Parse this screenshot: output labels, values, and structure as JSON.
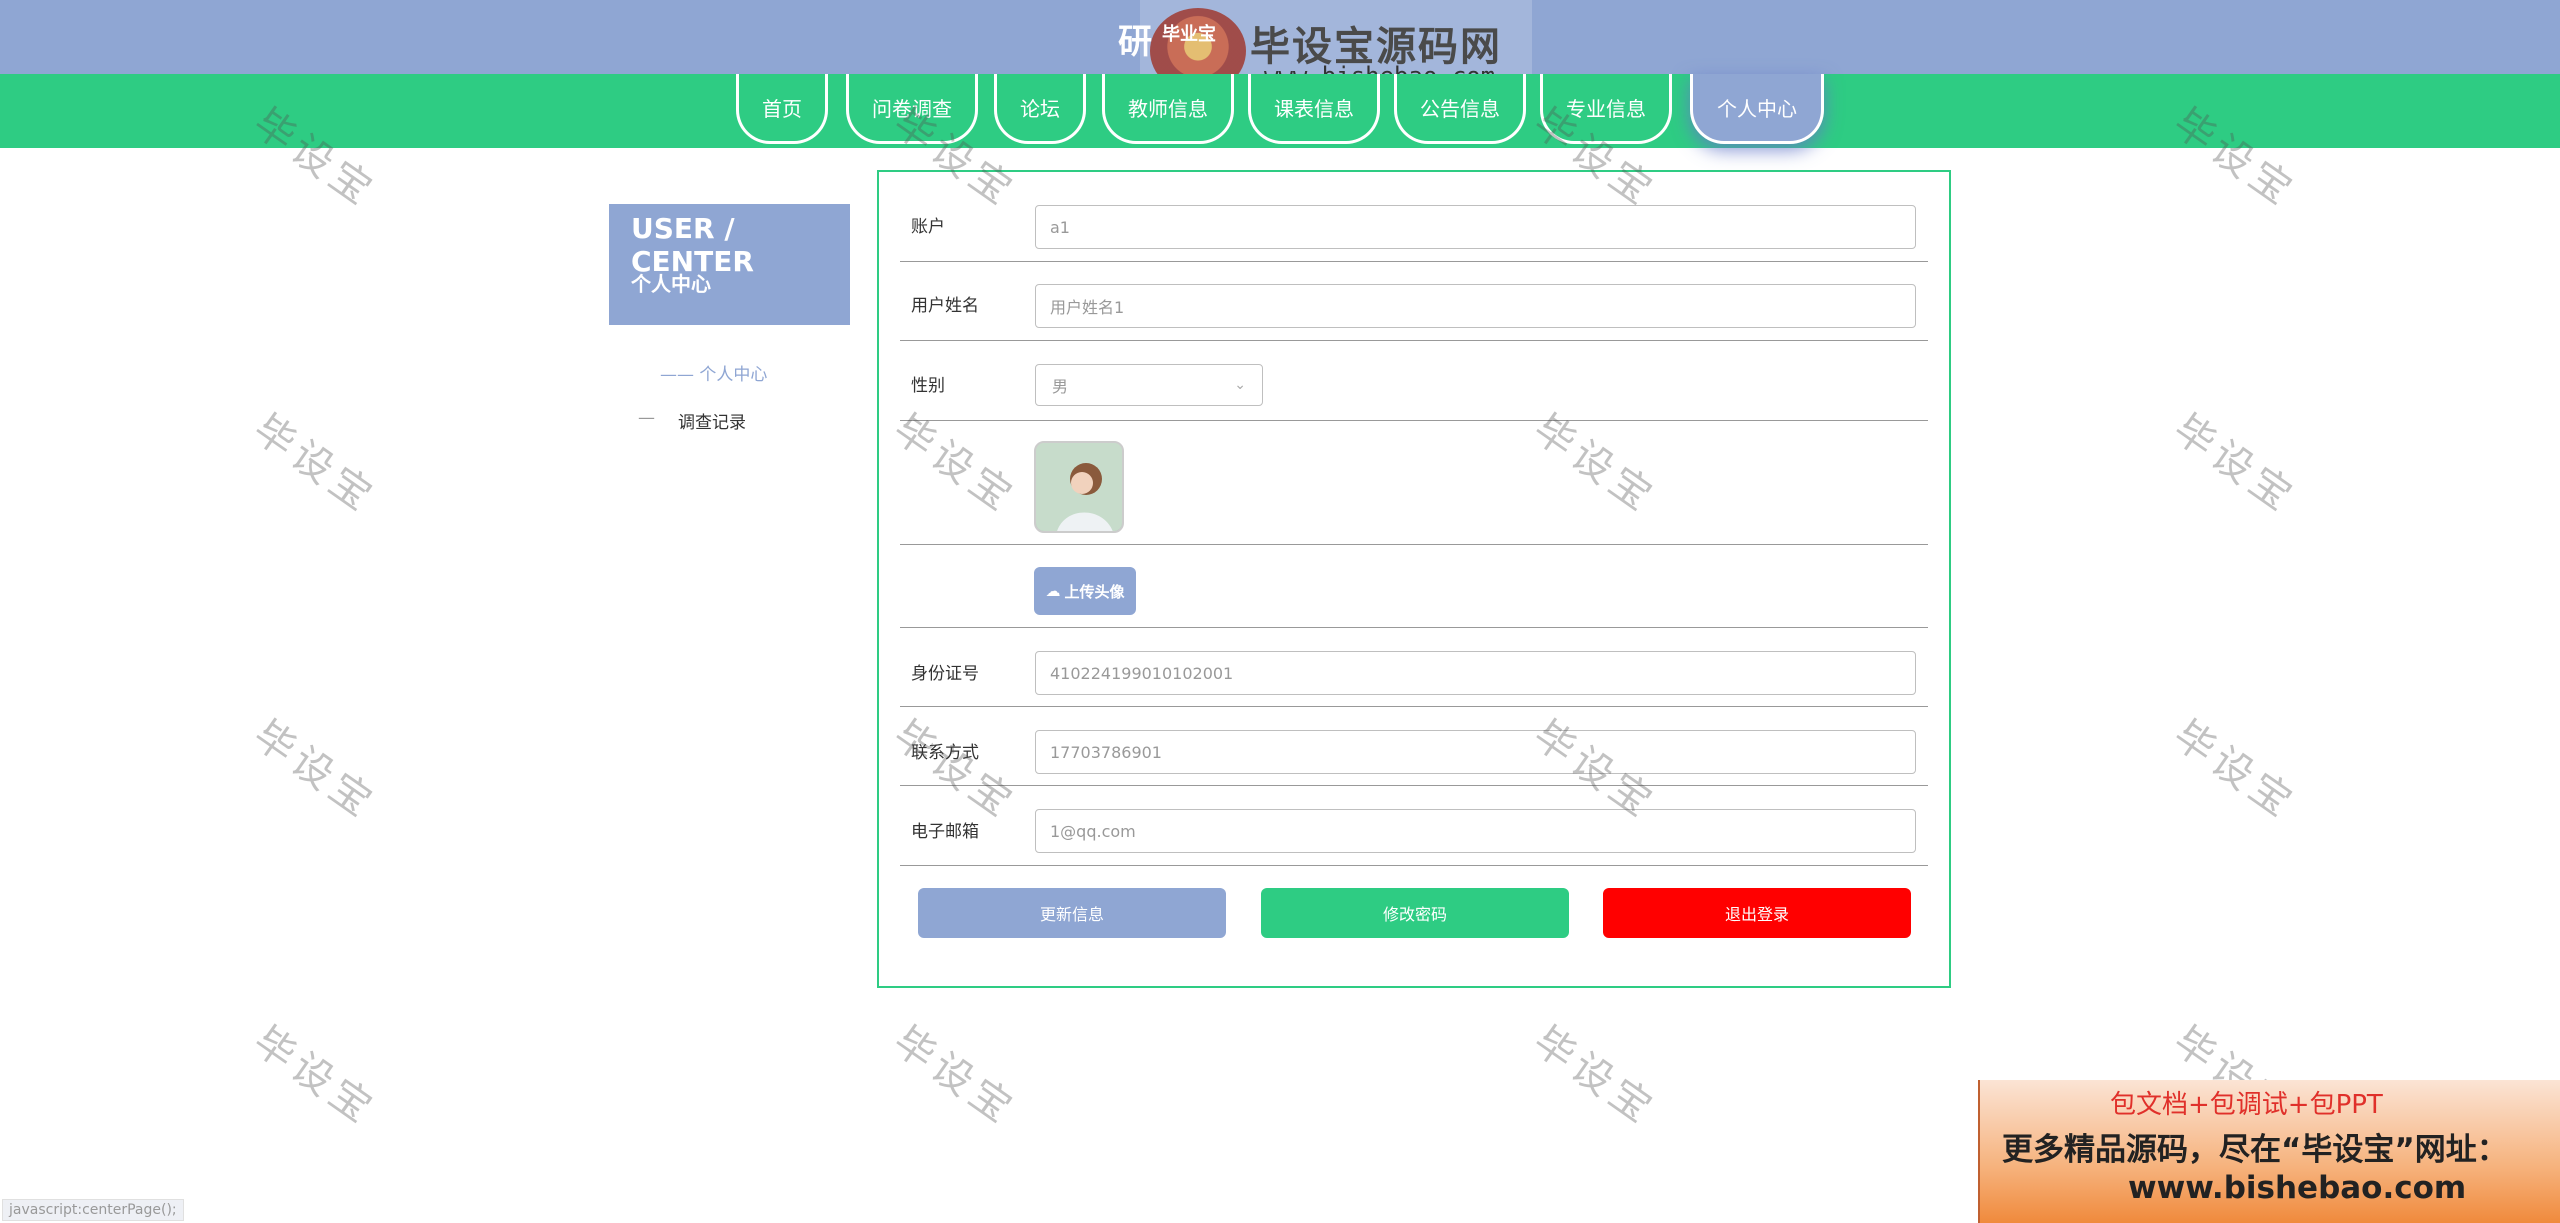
{
  "header": {
    "title": "研",
    "logo_badge": "毕业宝",
    "logo_text": "毕设宝源码网",
    "logo_url": "www.bishebao.com"
  },
  "nav": {
    "items": [
      {
        "label": "首页"
      },
      {
        "label": "问卷调查"
      },
      {
        "label": "论坛"
      },
      {
        "label": "教师信息"
      },
      {
        "label": "课表信息"
      },
      {
        "label": "公告信息"
      },
      {
        "label": "专业信息"
      },
      {
        "label": "个人中心",
        "active": true
      }
    ]
  },
  "sidebar": {
    "title_en": "USER / CENTER",
    "title_cn": "个人中心",
    "links": [
      {
        "label": "—— 个人中心",
        "active": true
      },
      {
        "label": "调查记录",
        "prefix": "—"
      }
    ]
  },
  "form": {
    "account_label": "账户",
    "account_placeholder": "a1",
    "name_label": "用户姓名",
    "name_placeholder": "用户姓名1",
    "gender_label": "性别",
    "gender_value": "男",
    "upload_label": "上传头像",
    "idcard_label": "身份证号",
    "idcard_value": "410224199010102001",
    "phone_label": "联系方式",
    "phone_value": "17703786901",
    "email_label": "电子邮箱",
    "email_value": "1@qq.com"
  },
  "actions": {
    "update": "更新信息",
    "change_password": "修改密码",
    "logout": "退出登录"
  },
  "watermark": "毕设宝",
  "ad": {
    "line1": "包文档+包调试+包PPT",
    "line2": "更多精品源码，尽在“毕设宝”网址：",
    "line3": "www.bishebao.com"
  },
  "statusbar": "javascript:centerPage();",
  "colors": {
    "header_bg": "#8fa6d3",
    "nav_bg": "#2ecc83",
    "accent_blue": "#8fa6d3",
    "accent_green": "#2ecc83",
    "danger_red": "#ff0000"
  }
}
